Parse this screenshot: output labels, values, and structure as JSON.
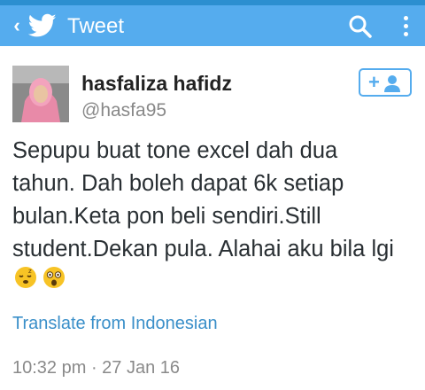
{
  "appbar": {
    "title": "Tweet",
    "icons": [
      "back-chevron-icon",
      "twitter-bird-icon",
      "search-icon",
      "overflow-menu-icon"
    ],
    "color": "#55acee"
  },
  "tweet": {
    "author_name": "hasfaliza hafidz",
    "author_handle": "@hasfa95",
    "follow_icon": "add-user-icon",
    "follow_plus": "+",
    "text_lines": [
      "Sepupu buat tone excel dah dua",
      "tahun. Dah boleh dapat 6k setiap",
      "bulan.Keta pon beli sendiri.Still",
      "student.Dekan pula. Alahai aku bila lgi"
    ],
    "emojis": [
      "sleepy-face-icon",
      "astonished-face-icon"
    ],
    "translate_link": "Translate from Indonesian",
    "timestamp": "10:32 pm · 27 Jan 16"
  }
}
